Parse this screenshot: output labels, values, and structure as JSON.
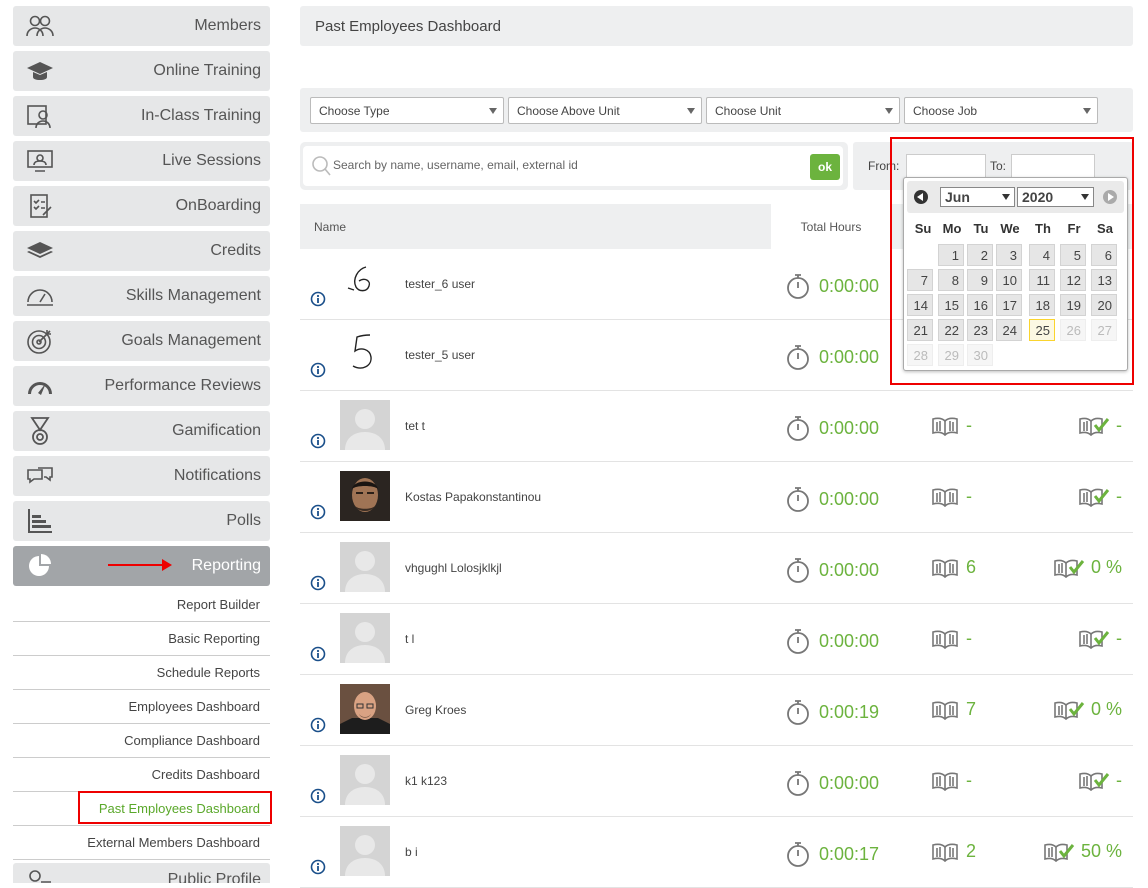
{
  "sidebar": {
    "items": [
      {
        "label": "Members",
        "icon": "members-icon"
      },
      {
        "label": "Online Training",
        "icon": "graduation-cap-icon"
      },
      {
        "label": "In-Class Training",
        "icon": "classroom-icon"
      },
      {
        "label": "Live Sessions",
        "icon": "live-session-icon"
      },
      {
        "label": "OnBoarding",
        "icon": "checklist-icon"
      },
      {
        "label": "Credits",
        "icon": "layers-icon"
      },
      {
        "label": "Skills Management",
        "icon": "gauge-icon"
      },
      {
        "label": "Goals Management",
        "icon": "target-icon"
      },
      {
        "label": "Performance Reviews",
        "icon": "speedometer-icon"
      },
      {
        "label": "Gamification",
        "icon": "medal-icon"
      },
      {
        "label": "Notifications",
        "icon": "chat-icon"
      },
      {
        "label": "Polls",
        "icon": "bar-chart-icon"
      },
      {
        "label": "Reporting",
        "icon": "pie-chart-icon",
        "active": true
      }
    ],
    "reporting_sub": [
      {
        "label": "Report Builder"
      },
      {
        "label": "Basic Reporting"
      },
      {
        "label": "Schedule Reports"
      },
      {
        "label": "Employees Dashboard"
      },
      {
        "label": "Compliance Dashboard"
      },
      {
        "label": "Credits Dashboard"
      },
      {
        "label": "Past Employees Dashboard",
        "active": true
      },
      {
        "label": "External Members Dashboard"
      }
    ],
    "next_item": {
      "label": "Public Profile",
      "icon": "profile-icon"
    }
  },
  "page": {
    "title": "Past Employees Dashboard"
  },
  "filters": {
    "type": "Choose Type",
    "above_unit": "Choose Above Unit",
    "unit": "Choose Unit",
    "job": "Choose Job"
  },
  "search": {
    "placeholder": "Search by name, username, email, external id",
    "button": "ok"
  },
  "date_range": {
    "from_label": "From:",
    "to_label": "To:",
    "from_value": "",
    "to_value": ""
  },
  "datepicker": {
    "month": "Jun",
    "year": "2020",
    "weekdays": [
      "Su",
      "Mo",
      "Tu",
      "We",
      "Th",
      "Fr",
      "Sa"
    ],
    "today": "25"
  },
  "table": {
    "headers": {
      "name": "Name",
      "total_hours": "Total Hours"
    },
    "rows": [
      {
        "name": "tester_6 user",
        "hours": "0:00:00",
        "courses": "",
        "completion": "",
        "avatar": "handwritten-6"
      },
      {
        "name": "tester_5 user",
        "hours": "0:00:00",
        "courses": "",
        "completion": "",
        "avatar": "handwritten-5"
      },
      {
        "name": "tet t",
        "hours": "0:00:00",
        "courses": "-",
        "completion": "-",
        "avatar": "default"
      },
      {
        "name": "Kostas Papakonstantinou",
        "hours": "0:00:00",
        "courses": "-",
        "completion": "-",
        "avatar": "photo-dark"
      },
      {
        "name": "vhgughl Lolosjklkjl",
        "hours": "0:00:00",
        "courses": "6",
        "completion": "0 %",
        "avatar": "default"
      },
      {
        "name": "t l",
        "hours": "0:00:00",
        "courses": "-",
        "completion": "-",
        "avatar": "default"
      },
      {
        "name": "Greg Kroes",
        "hours": "0:00:19",
        "courses": "7",
        "completion": "0 %",
        "avatar": "photo-bald"
      },
      {
        "name": "k1 k123",
        "hours": "0:00:00",
        "courses": "-",
        "completion": "-",
        "avatar": "default"
      },
      {
        "name": "b i",
        "hours": "0:00:17",
        "courses": "2",
        "completion": "50 %",
        "avatar": "default"
      }
    ]
  },
  "colors": {
    "accent_green": "#6cb33e",
    "highlight_red": "#ee0000",
    "panel_gray": "#eeeff0"
  }
}
